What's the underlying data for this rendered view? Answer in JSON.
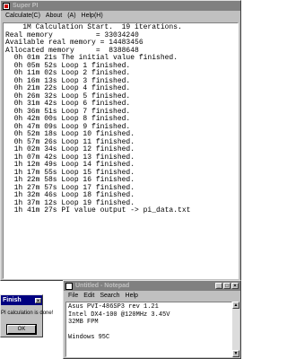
{
  "superpi": {
    "title": "Super PI",
    "menu": [
      {
        "label": "Calculate(C)"
      },
      {
        "label": "About"
      },
      {
        "label": "(A)"
      },
      {
        "label": "Help(H)"
      }
    ],
    "output_lines": [
      "    1M Calculation Start.  19 iterations.",
      "Real memory          = 33034240",
      "Available real memory = 14483456",
      "Allocated memory     =  8388648",
      "  0h 01m 21s The initial value finished.",
      "  0h 05m 52s Loop 1 finished.",
      "  0h 11m 02s Loop 2 finished.",
      "  0h 16m 13s Loop 3 finished.",
      "  0h 21m 22s Loop 4 finished.",
      "  0h 26m 32s Loop 5 finished.",
      "  0h 31m 42s Loop 6 finished.",
      "  0h 36m 51s Loop 7 finished.",
      "  0h 42m 00s Loop 8 finished.",
      "  0h 47m 09s Loop 9 finished.",
      "  0h 52m 18s Loop 10 finished.",
      "  0h 57m 26s Loop 11 finished.",
      "  1h 02m 34s Loop 12 finished.",
      "  1h 07m 42s Loop 13 finished.",
      "  1h 12m 49s Loop 14 finished.",
      "  1h 17m 55s Loop 15 finished.",
      "  1h 22m 58s Loop 16 finished.",
      "  1h 27m 57s Loop 17 finished.",
      "  1h 32m 46s Loop 18 finished.",
      "  1h 37m 12s Loop 19 finished.",
      "  1h 41m 27s PI value output -> pi_data.txt"
    ]
  },
  "finish_dialog": {
    "title": "Finish",
    "message": "PI calculation is done!",
    "ok_label": "OK",
    "close_glyph": "×"
  },
  "notepad": {
    "title": "Untitled - Notepad",
    "menu": [
      {
        "label": "File"
      },
      {
        "label": "Edit"
      },
      {
        "label": "Search"
      },
      {
        "label": "Help"
      }
    ],
    "content_lines": [
      "Asus PVI-486SP3 rev 1.21",
      "Intel DX4-100 @120MHz 3.45V",
      "32MB FPM",
      "",
      "Windows 95C"
    ],
    "minimize_glyph": "_",
    "maximize_glyph": "□",
    "close_glyph": "×"
  }
}
